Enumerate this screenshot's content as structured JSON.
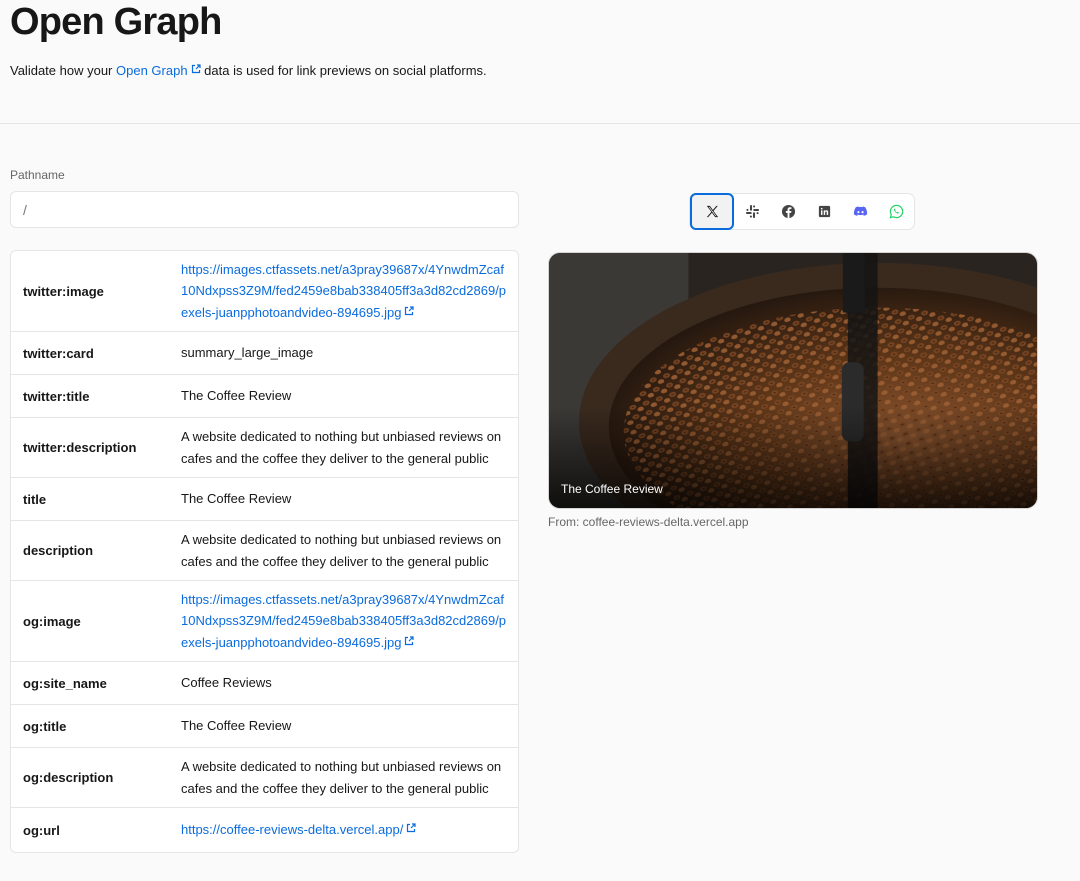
{
  "header": {
    "title": "Open Graph",
    "subtitle_before": "Validate how your ",
    "subtitle_link": "Open Graph",
    "subtitle_after": " data is used for link previews on social platforms."
  },
  "pathname": {
    "label": "Pathname",
    "placeholder": "/"
  },
  "platforms": [
    "x-icon",
    "slack-icon",
    "facebook-icon",
    "linkedin-icon",
    "discord-icon",
    "whatsapp-icon"
  ],
  "rows": [
    {
      "key": "twitter:image",
      "value": "https://images.ctfassets.net/a3pray39687x/4YnwdmZcaf10Ndxpss3Z9M/fed2459e8bab338405ff3a3d82cd2869/pexels-juanpphotoandvideo-894695.jpg",
      "is_link": true
    },
    {
      "key": "twitter:card",
      "value": "summary_large_image",
      "is_link": false
    },
    {
      "key": "twitter:title",
      "value": "The Coffee Review",
      "is_link": false
    },
    {
      "key": "twitter:description",
      "value": "A website dedicated to nothing but unbiased reviews on cafes and the coffee they deliver to the general public",
      "is_link": false
    },
    {
      "key": "title",
      "value": "The Coffee Review",
      "is_link": false
    },
    {
      "key": "description",
      "value": "A website dedicated to nothing but unbiased reviews on cafes and the coffee they deliver to the general public",
      "is_link": false
    },
    {
      "key": "og:image",
      "value": "https://images.ctfassets.net/a3pray39687x/4YnwdmZcaf10Ndxpss3Z9M/fed2459e8bab338405ff3a3d82cd2869/pexels-juanpphotoandvideo-894695.jpg",
      "is_link": true
    },
    {
      "key": "og:site_name",
      "value": "Coffee Reviews",
      "is_link": false
    },
    {
      "key": "og:title",
      "value": "The Coffee Review",
      "is_link": false
    },
    {
      "key": "og:description",
      "value": "A website dedicated to nothing but unbiased reviews on cafes and the coffee they deliver to the general public",
      "is_link": false
    },
    {
      "key": "og:url",
      "value": "https://coffee-reviews-delta.vercel.app/",
      "is_link": true
    }
  ],
  "preview": {
    "card_title": "The Coffee Review",
    "from": "From: coffee-reviews-delta.vercel.app"
  },
  "colors": {
    "link": "#0a6bdc",
    "active_border": "#0a6bdc",
    "whatsapp": "#25d366",
    "discord": "#5865f2"
  }
}
